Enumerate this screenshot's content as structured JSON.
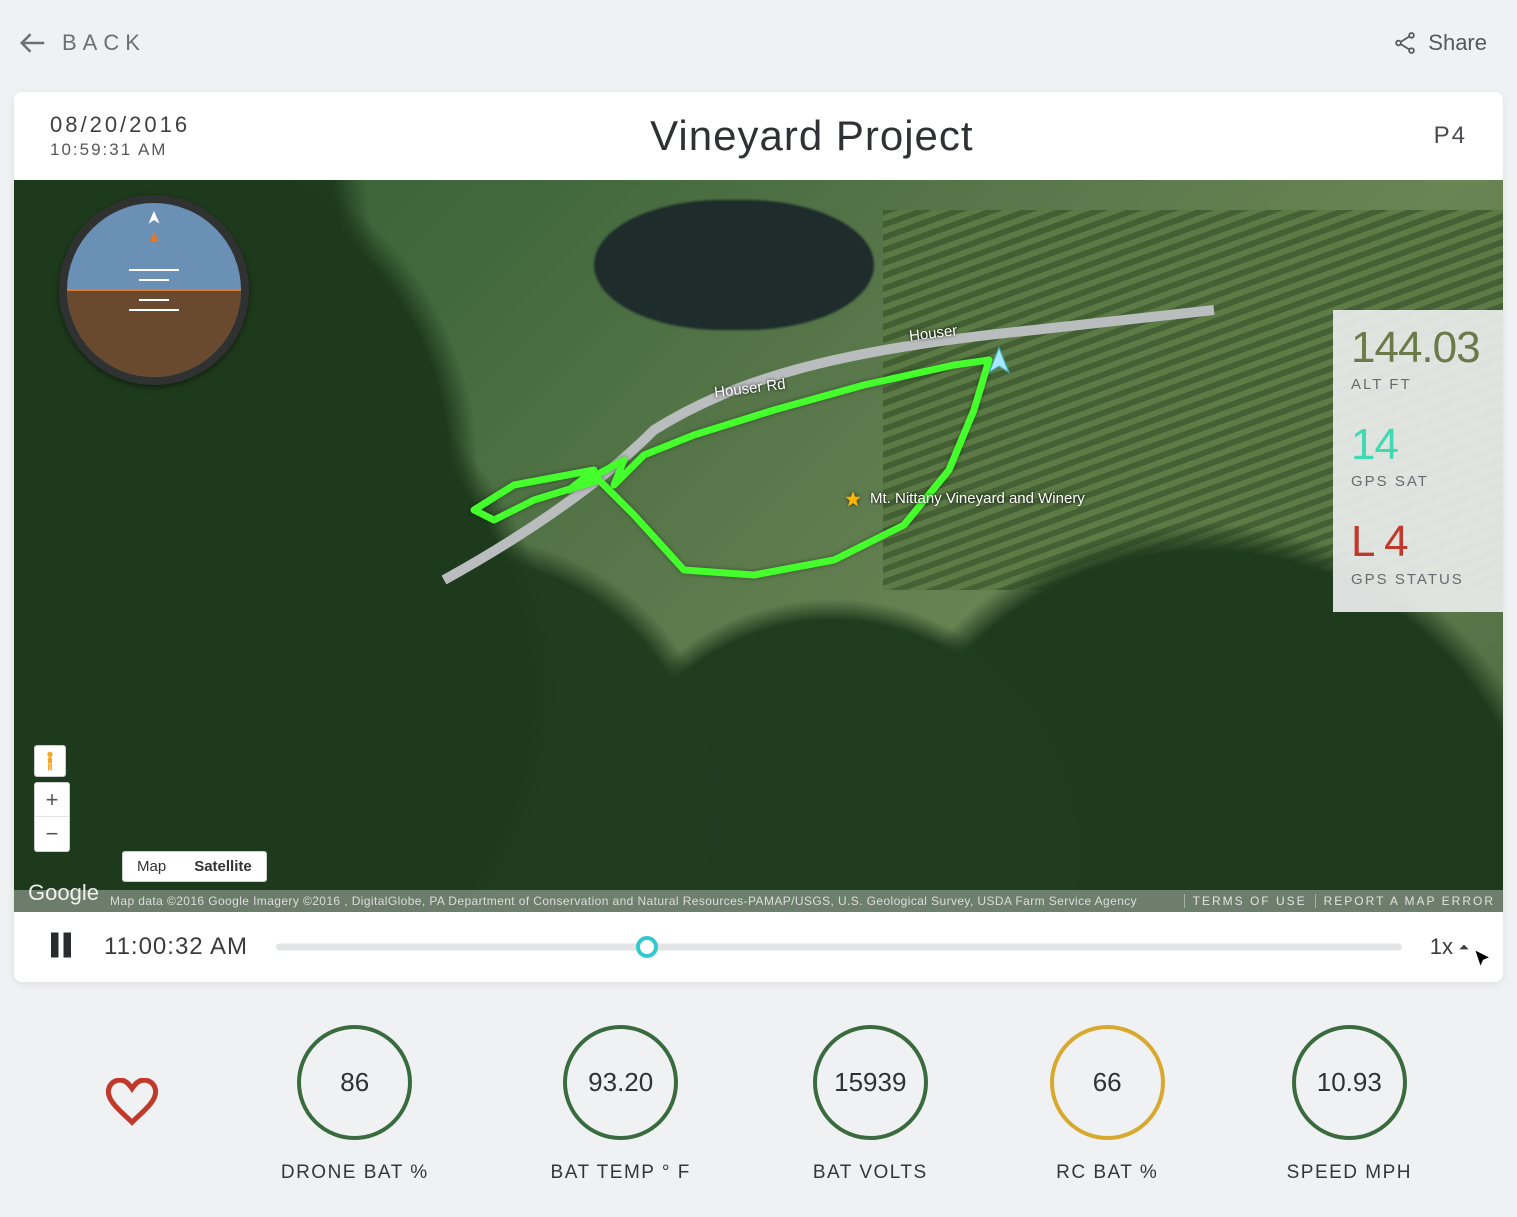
{
  "topbar": {
    "back_label": "BACK",
    "share_label": "Share"
  },
  "header": {
    "date": "08/20/2016",
    "time": "10:59:31 AM",
    "title": "Vineyard Project",
    "model": "P4"
  },
  "map": {
    "road_labels": [
      "Houser Rd",
      "Houser"
    ],
    "poi_name": "Mt. Nittany Vineyard and Winery",
    "type_tabs": {
      "map": "Map",
      "satellite": "Satellite",
      "active": "satellite"
    },
    "logo": "Google",
    "attribution": "Map data ©2016 Google Imagery ©2016 , DigitalGlobe, PA Department of Conservation and Natural Resources-PAMAP/USGS, U.S. Geological Survey, USDA Farm Service Agency",
    "terms_label": "TERMS OF USE",
    "report_label": "REPORT A MAP ERROR",
    "zoom_in": "+",
    "zoom_out": "−"
  },
  "telemetry": {
    "alt_value": "144.03",
    "alt_label": "ALT FT",
    "sat_value": "14",
    "sat_label": "GPS SAT",
    "status_value": "L 4",
    "status_label": "GPS STATUS"
  },
  "playback": {
    "time": "11:00:32 AM",
    "progress_percent": 33,
    "speed_label": "1x"
  },
  "metrics": [
    {
      "value": "86",
      "label": "DRONE BAT %",
      "ring": "green"
    },
    {
      "value": "93.20",
      "label": "BAT TEMP ° F",
      "ring": "green"
    },
    {
      "value": "15939",
      "label": "BAT VOLTS",
      "ring": "green"
    },
    {
      "value": "66",
      "label": "RC BAT %",
      "ring": "yellow"
    },
    {
      "value": "10.93",
      "label": "SPEED MPH",
      "ring": "green"
    }
  ]
}
